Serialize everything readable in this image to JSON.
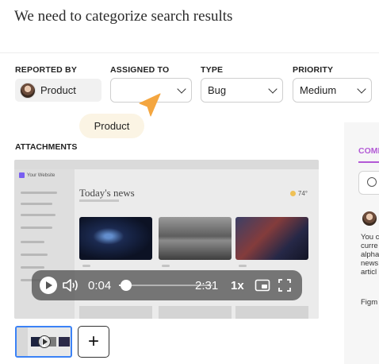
{
  "issue": {
    "title": "We need to categorize search results"
  },
  "fields": {
    "reported_by": {
      "label": "REPORTED BY",
      "value": "Product"
    },
    "assigned_to": {
      "label": "ASSIGNED TO",
      "value": ""
    },
    "type": {
      "label": "TYPE",
      "value": "Bug"
    },
    "priority": {
      "label": "PRIORITY",
      "value": "Medium"
    }
  },
  "tooltip": {
    "text": "Product"
  },
  "attachments": {
    "label": "ATTACHMENTS",
    "video": {
      "preview_title": "Today's news",
      "preview_app": "Your Website",
      "preview_temp": "74°",
      "current_time": "0:04",
      "duration": "2:31",
      "speed": "1x",
      "progress": 0.03
    },
    "add_label": "+"
  },
  "comments_panel": {
    "heading": "COMMENTS",
    "lines": [
      "You c",
      "curre",
      "alpha",
      "news",
      "articl"
    ],
    "footer": "Figm"
  }
}
